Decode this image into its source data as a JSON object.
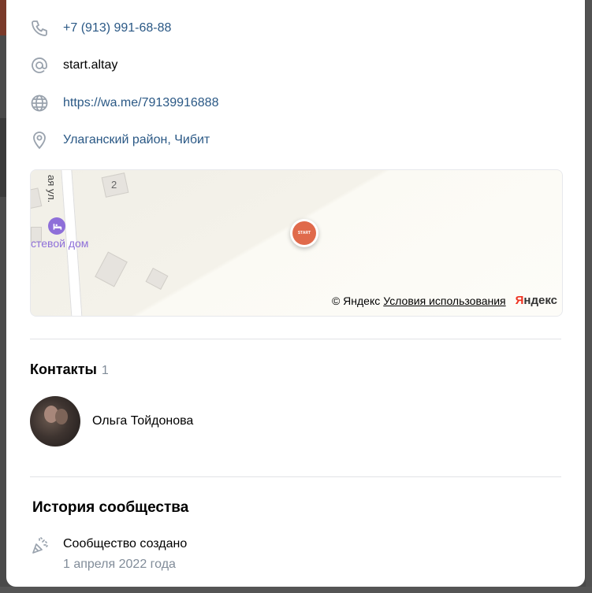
{
  "info": {
    "phone": "+7 (913) 991-68-88",
    "screen_name": "start.altay",
    "website": "https://wa.me/79139916888",
    "address": "Улаганский район, Чибит"
  },
  "map": {
    "house_number": "2",
    "street_fragment": "ая ул.",
    "poi_label": "стевой дом",
    "marker_text": "START",
    "attribution": "© Яндекс",
    "terms_link": "Условия использования",
    "logo_y": "Я",
    "logo_rest": "ндекс"
  },
  "contacts": {
    "title": "Контакты",
    "count": "1",
    "items": [
      {
        "name": "Ольга Тойдонова"
      }
    ]
  },
  "history": {
    "title": "История сообщества",
    "event_label": "Сообщество создано",
    "event_date": "1 апреля 2022 года"
  },
  "colors": {
    "link": "#2a5885",
    "secondary": "#818c99",
    "poi": "#8e6fd9",
    "marker": "#e06a4b"
  }
}
